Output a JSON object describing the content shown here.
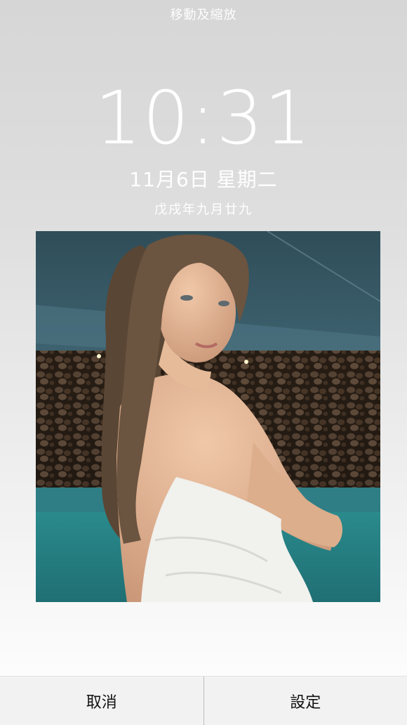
{
  "header": {
    "title": "移動及縮放"
  },
  "lockscreen": {
    "time": "10:31",
    "date": "11月6日 星期二",
    "lunar_date": "戊戌年九月廿九"
  },
  "bottom_bar": {
    "cancel_label": "取消",
    "set_label": "設定"
  },
  "colors": {
    "pool_water": "#2a8f8d",
    "ceiling": "#2c4a55",
    "towel": "#f4f4f2"
  }
}
